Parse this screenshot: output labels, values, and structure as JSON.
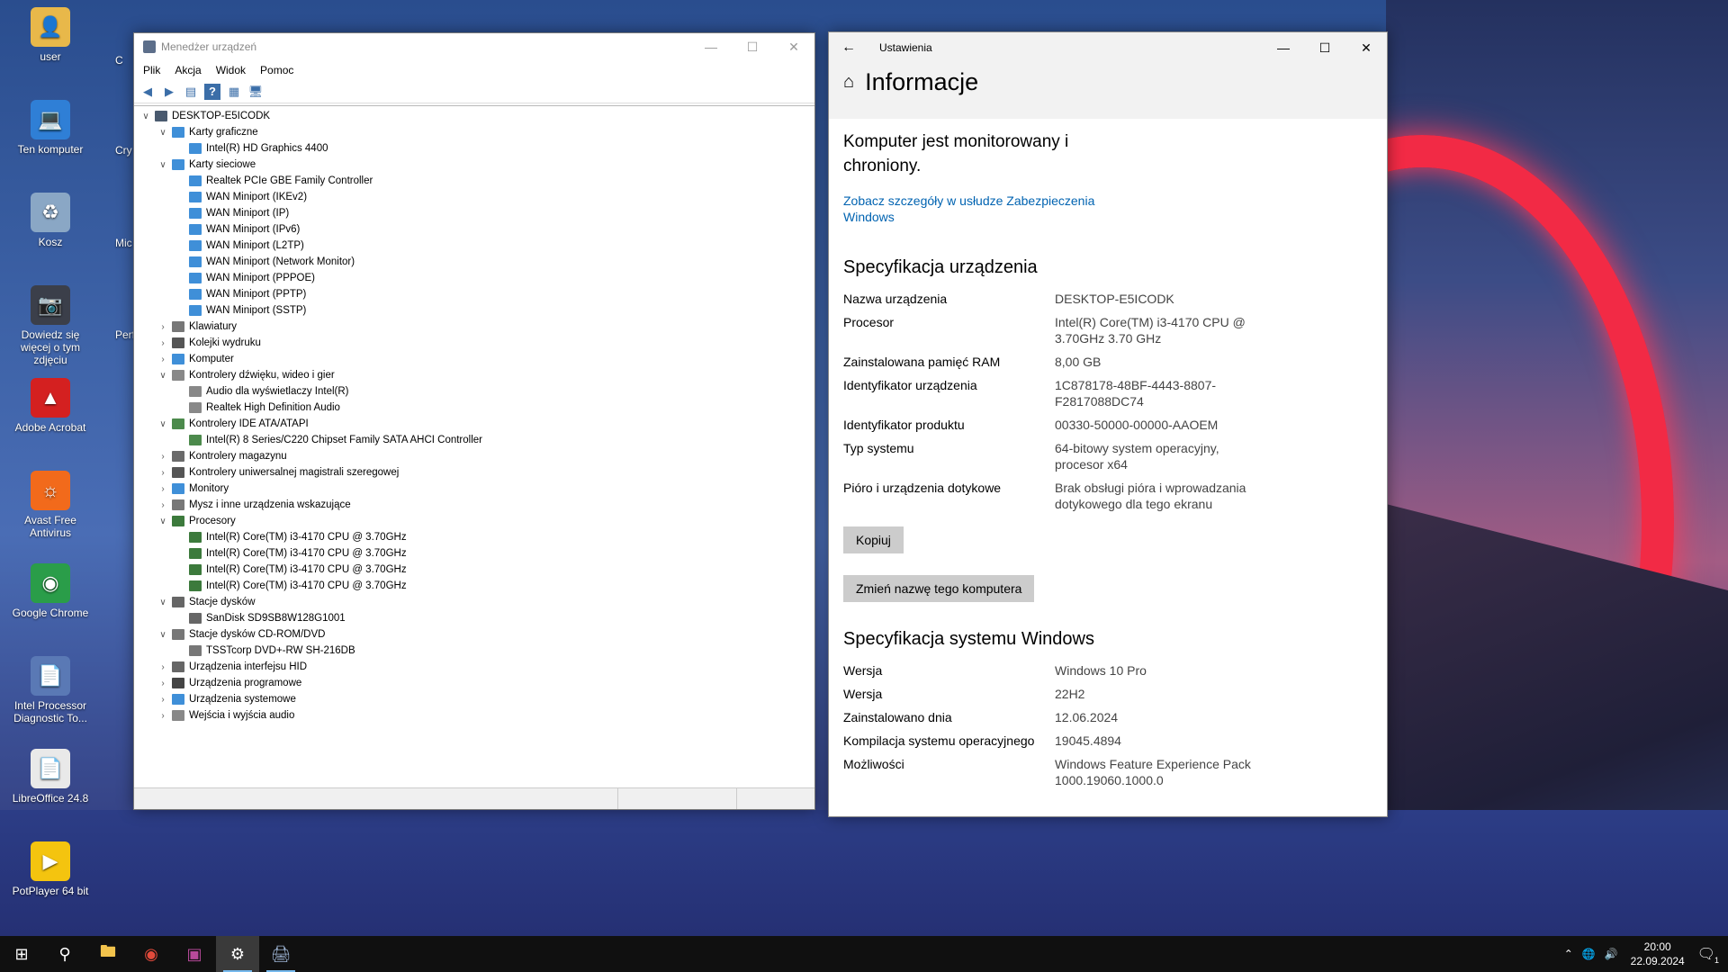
{
  "desktop": {
    "icons": [
      {
        "label": "user",
        "icon": "user-folder-icon",
        "color": "#e8b84a"
      },
      {
        "label": "Ten komputer",
        "icon": "computer-icon",
        "color": "#2f7fd6"
      },
      {
        "label": "Kosz",
        "icon": "recycle-bin-icon",
        "color": "#8aa7c5"
      },
      {
        "label": "Dowiedz się więcej o tym zdjęciu",
        "icon": "camera-info-icon",
        "color": "#3b3f4a"
      },
      {
        "label": "Adobe Acrobat",
        "icon": "acrobat-icon",
        "color": "#d42020"
      },
      {
        "label": "Avast Free Antivirus",
        "icon": "avast-icon",
        "color": "#f26a1b"
      },
      {
        "label": "Google Chrome",
        "icon": "chrome-icon",
        "color": "#2a9d49"
      },
      {
        "label": "Intel Processor Diagnostic To...",
        "icon": "intel-diagnostic-icon",
        "color": "#5a79b5"
      },
      {
        "label": "LibreOffice 24.8",
        "icon": "libreoffice-icon",
        "color": "#e9e9e9"
      },
      {
        "label": "PotPlayer 64 bit",
        "icon": "potplayer-icon",
        "color": "#f4c40f"
      }
    ],
    "clipped": [
      "C",
      "Cry",
      "Mic",
      "Perfo"
    ]
  },
  "device_manager": {
    "title": "Menedżer urządzeń",
    "menu": [
      "Plik",
      "Akcja",
      "Widok",
      "Pomoc"
    ],
    "tree": [
      {
        "label": "DESKTOP-E5ICODK",
        "level": 0,
        "exp": "open",
        "icon": "computer-root-icon",
        "color": "#4a5a6f"
      },
      {
        "label": "Karty graficzne",
        "level": 1,
        "exp": "open",
        "icon": "display-adapter-icon",
        "color": "#3f8fd8"
      },
      {
        "label": "Intel(R) HD Graphics 4400",
        "level": 2,
        "exp": "none",
        "icon": "display-adapter-icon",
        "color": "#3f8fd8"
      },
      {
        "label": "Karty sieciowe",
        "level": 1,
        "exp": "open",
        "icon": "network-adapter-icon",
        "color": "#3f8fd8"
      },
      {
        "label": "Realtek PCIe GBE Family Controller",
        "level": 2,
        "exp": "none",
        "icon": "network-adapter-icon",
        "color": "#3f8fd8"
      },
      {
        "label": "WAN Miniport (IKEv2)",
        "level": 2,
        "exp": "none",
        "icon": "network-adapter-icon",
        "color": "#3f8fd8"
      },
      {
        "label": "WAN Miniport (IP)",
        "level": 2,
        "exp": "none",
        "icon": "network-adapter-icon",
        "color": "#3f8fd8"
      },
      {
        "label": "WAN Miniport (IPv6)",
        "level": 2,
        "exp": "none",
        "icon": "network-adapter-icon",
        "color": "#3f8fd8"
      },
      {
        "label": "WAN Miniport (L2TP)",
        "level": 2,
        "exp": "none",
        "icon": "network-adapter-icon",
        "color": "#3f8fd8"
      },
      {
        "label": "WAN Miniport (Network Monitor)",
        "level": 2,
        "exp": "none",
        "icon": "network-adapter-icon",
        "color": "#3f8fd8"
      },
      {
        "label": "WAN Miniport (PPPOE)",
        "level": 2,
        "exp": "none",
        "icon": "network-adapter-icon",
        "color": "#3f8fd8"
      },
      {
        "label": "WAN Miniport (PPTP)",
        "level": 2,
        "exp": "none",
        "icon": "network-adapter-icon",
        "color": "#3f8fd8"
      },
      {
        "label": "WAN Miniport (SSTP)",
        "level": 2,
        "exp": "none",
        "icon": "network-adapter-icon",
        "color": "#3f8fd8"
      },
      {
        "label": "Klawiatury",
        "level": 1,
        "exp": "closed",
        "icon": "keyboard-icon",
        "color": "#777777"
      },
      {
        "label": "Kolejki wydruku",
        "level": 1,
        "exp": "closed",
        "icon": "printer-icon",
        "color": "#555555"
      },
      {
        "label": "Komputer",
        "level": 1,
        "exp": "closed",
        "icon": "computer-icon",
        "color": "#3f8fd8"
      },
      {
        "label": "Kontrolery dźwięku, wideo i gier",
        "level": 1,
        "exp": "open",
        "icon": "speaker-icon",
        "color": "#888888"
      },
      {
        "label": "Audio dla wyświetlaczy Intel(R)",
        "level": 2,
        "exp": "none",
        "icon": "speaker-icon",
        "color": "#888888"
      },
      {
        "label": "Realtek High Definition Audio",
        "level": 2,
        "exp": "none",
        "icon": "speaker-icon",
        "color": "#888888"
      },
      {
        "label": "Kontrolery IDE ATA/ATAPI",
        "level": 1,
        "exp": "open",
        "icon": "ide-controller-icon",
        "color": "#4c8a4c"
      },
      {
        "label": "Intel(R) 8 Series/C220 Chipset Family SATA AHCI Controller",
        "level": 2,
        "exp": "none",
        "icon": "ide-controller-icon",
        "color": "#4c8a4c"
      },
      {
        "label": "Kontrolery magazynu",
        "level": 1,
        "exp": "closed",
        "icon": "storage-controller-icon",
        "color": "#6a6a6a"
      },
      {
        "label": "Kontrolery uniwersalnej magistrali szeregowej",
        "level": 1,
        "exp": "closed",
        "icon": "usb-icon",
        "color": "#555555"
      },
      {
        "label": "Monitory",
        "level": 1,
        "exp": "closed",
        "icon": "monitor-icon",
        "color": "#3f8fd8"
      },
      {
        "label": "Mysz i inne urządzenia wskazujące",
        "level": 1,
        "exp": "closed",
        "icon": "mouse-icon",
        "color": "#777777"
      },
      {
        "label": "Procesory",
        "level": 1,
        "exp": "open",
        "icon": "processor-icon",
        "color": "#3c7a3c"
      },
      {
        "label": "Intel(R) Core(TM) i3-4170 CPU @ 3.70GHz",
        "level": 2,
        "exp": "none",
        "icon": "processor-icon",
        "color": "#3c7a3c"
      },
      {
        "label": "Intel(R) Core(TM) i3-4170 CPU @ 3.70GHz",
        "level": 2,
        "exp": "none",
        "icon": "processor-icon",
        "color": "#3c7a3c"
      },
      {
        "label": "Intel(R) Core(TM) i3-4170 CPU @ 3.70GHz",
        "level": 2,
        "exp": "none",
        "icon": "processor-icon",
        "color": "#3c7a3c"
      },
      {
        "label": "Intel(R) Core(TM) i3-4170 CPU @ 3.70GHz",
        "level": 2,
        "exp": "none",
        "icon": "processor-icon",
        "color": "#3c7a3c"
      },
      {
        "label": "Stacje dysków",
        "level": 1,
        "exp": "open",
        "icon": "disk-drive-icon",
        "color": "#666666"
      },
      {
        "label": "SanDisk SD9SB8W128G1001",
        "level": 2,
        "exp": "none",
        "icon": "disk-drive-icon",
        "color": "#666666"
      },
      {
        "label": "Stacje dysków CD-ROM/DVD",
        "level": 1,
        "exp": "open",
        "icon": "dvd-drive-icon",
        "color": "#777777"
      },
      {
        "label": "TSSTcorp DVD+-RW SH-216DB",
        "level": 2,
        "exp": "none",
        "icon": "dvd-drive-icon",
        "color": "#777777"
      },
      {
        "label": "Urządzenia interfejsu HID",
        "level": 1,
        "exp": "closed",
        "icon": "hid-icon",
        "color": "#666666"
      },
      {
        "label": "Urządzenia programowe",
        "level": 1,
        "exp": "closed",
        "icon": "software-device-icon",
        "color": "#444444"
      },
      {
        "label": "Urządzenia systemowe",
        "level": 1,
        "exp": "closed",
        "icon": "system-device-icon",
        "color": "#3f8fd8"
      },
      {
        "label": "Wejścia i wyjścia audio",
        "level": 1,
        "exp": "closed",
        "icon": "audio-io-icon",
        "color": "#888888"
      }
    ]
  },
  "settings": {
    "window_title": "Ustawienia",
    "page_title": "Informacje",
    "protection_text": "Komputer jest monitorowany i chroniony.",
    "security_link": "Zobacz szczegóły w usłudze Zabezpieczenia Windows",
    "device_spec_title": "Specyfikacja urządzenia",
    "device_spec": [
      {
        "k": "Nazwa urządzenia",
        "v": "DESKTOP-E5ICODK"
      },
      {
        "k": "Procesor",
        "v": "Intel(R) Core(TM) i3-4170 CPU @ 3.70GHz   3.70 GHz"
      },
      {
        "k": "Zainstalowana pamięć RAM",
        "v": "8,00 GB"
      },
      {
        "k": "Identyfikator urządzenia",
        "v": "1C878178-48BF-4443-8807-F2817088DC74"
      },
      {
        "k": "Identyfikator produktu",
        "v": "00330-50000-00000-AAOEM"
      },
      {
        "k": "Typ systemu",
        "v": "64-bitowy system operacyjny, procesor x64"
      },
      {
        "k": "Pióro i urządzenia dotykowe",
        "v": "Brak obsługi pióra i wprowadzania dotykowego dla tego ekranu"
      }
    ],
    "copy_button": "Kopiuj",
    "rename_button": "Zmień nazwę tego komputera",
    "windows_spec_title": "Specyfikacja systemu Windows",
    "windows_spec": [
      {
        "k": "Wersja",
        "v": "Windows 10 Pro"
      },
      {
        "k": "Wersja",
        "v": "22H2"
      },
      {
        "k": "Zainstalowano dnia",
        "v": "12.06.2024"
      },
      {
        "k": "Kompilacja systemu operacyjnego",
        "v": "19045.4894"
      },
      {
        "k": "Możliwości",
        "v": "Windows Feature Experience Pack 1000.19060.1000.0"
      }
    ]
  },
  "taskbar": {
    "time": "20:00",
    "date": "22.09.2024",
    "notification_count": "1"
  }
}
